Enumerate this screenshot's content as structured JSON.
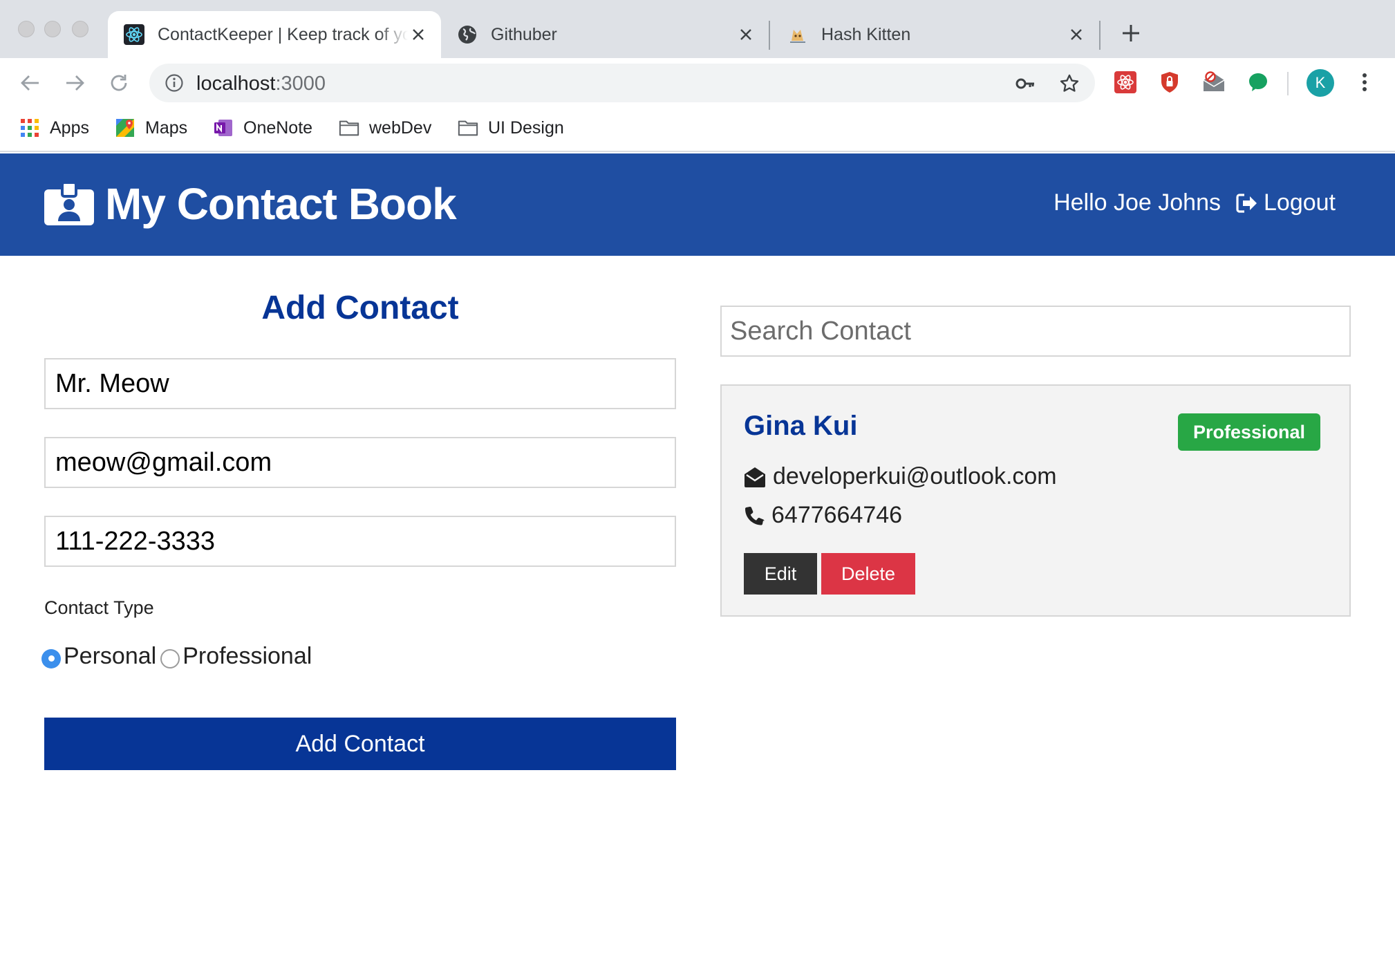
{
  "browser": {
    "tabs": [
      {
        "title": "ContactKeeper | Keep track of your contacts",
        "icon": "react-icon",
        "active": true
      },
      {
        "title": "Githuber",
        "icon": "globe-icon",
        "active": false
      },
      {
        "title": "Hash Kitten",
        "icon": "kitten-icon",
        "active": false
      }
    ],
    "url_host": "localhost",
    "url_port": ":3000",
    "profile_initial": "K",
    "bookmarks": [
      {
        "label": "Apps",
        "icon": "apps-grid-icon"
      },
      {
        "label": "Maps",
        "icon": "maps-icon"
      },
      {
        "label": "OneNote",
        "icon": "onenote-icon"
      },
      {
        "label": "webDev",
        "icon": "folder-icon"
      },
      {
        "label": "UI Design",
        "icon": "folder-icon"
      }
    ]
  },
  "app": {
    "brand": "My Contact Book",
    "brand_icon": "id-badge-icon",
    "greeting": "Hello Joe Johns",
    "logout_label": "Logout",
    "colors": {
      "navbar": "#1f4ea2",
      "primary": "#073596",
      "success": "#28a745",
      "danger": "#dc3545",
      "dark": "#333333"
    }
  },
  "form": {
    "title": "Add Contact",
    "name_value": "Mr. Meow",
    "email_value": "meow@gmail.com",
    "phone_value": "111-222-3333",
    "type_label": "Contact Type",
    "options": [
      {
        "label": "Personal",
        "checked": true
      },
      {
        "label": "Professional",
        "checked": false
      }
    ],
    "submit_label": "Add Contact"
  },
  "search": {
    "placeholder": "Search Contact"
  },
  "contacts": [
    {
      "name": "Gina Kui",
      "type": "Professional",
      "email": "developerkui@outlook.com",
      "phone": "6477664746",
      "edit_label": "Edit",
      "delete_label": "Delete"
    }
  ]
}
